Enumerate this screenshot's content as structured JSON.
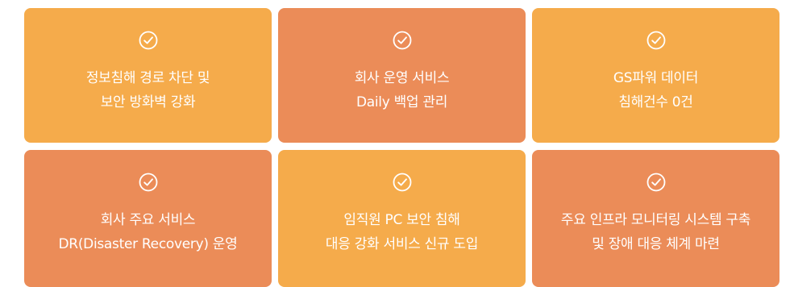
{
  "colors": {
    "yellow": "#f5ab4b",
    "orange": "#eb8c58",
    "text": "#ffffff"
  },
  "cards": [
    {
      "icon": "check-circle-icon",
      "lines": [
        "정보침해 경로 차단 및",
        "보안 방화벽 강화"
      ]
    },
    {
      "icon": "check-circle-icon",
      "lines": [
        "회사 운영 서비스",
        "Daily 백업 관리"
      ]
    },
    {
      "icon": "check-circle-icon",
      "lines": [
        "GS파워 데이터",
        "침해건수 0건"
      ]
    },
    {
      "icon": "check-circle-icon",
      "lines": [
        "회사 주요 서비스",
        "DR(Disaster Recovery) 운영"
      ]
    },
    {
      "icon": "check-circle-icon",
      "lines": [
        "임직원 PC 보안 침해",
        "대응 강화 서비스 신규 도입"
      ]
    },
    {
      "icon": "check-circle-icon",
      "lines": [
        "주요 인프라 모니터링 시스템 구축",
        "및 장애 대응 체계 마련"
      ]
    }
  ]
}
